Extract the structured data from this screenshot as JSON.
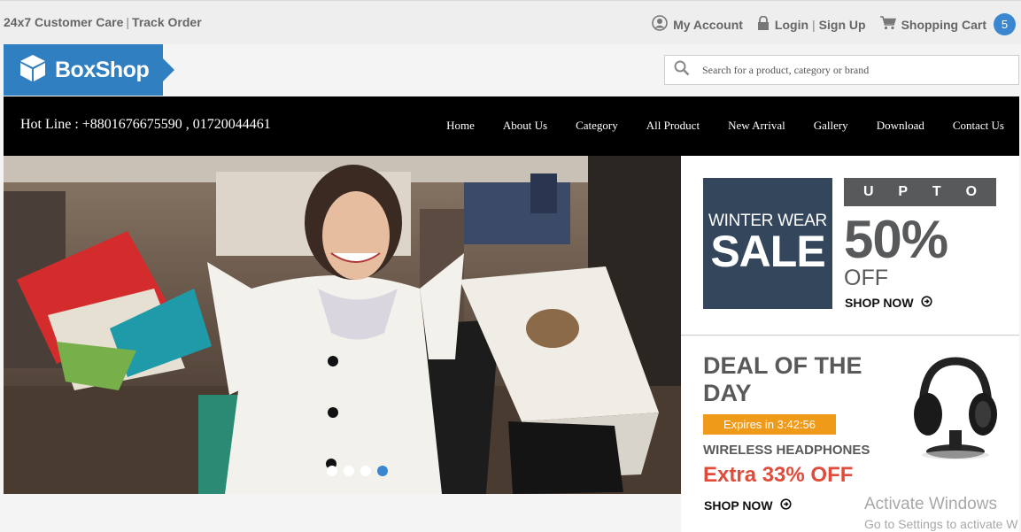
{
  "topbar": {
    "customer_care": "24x7 Customer Care",
    "separator": "|",
    "track_order": "Track Order",
    "my_account": "My Account",
    "login": "Login",
    "signup": "Sign Up",
    "shopping_cart": "Shopping Cart",
    "cart_count": "5"
  },
  "header": {
    "logo_text": "BoxShop",
    "search_placeholder": "Search for a product, category or brand"
  },
  "navbar": {
    "hotline": "Hot Line : +8801676675590 , 01720044461",
    "items": [
      "Home",
      "About Us",
      "Category",
      "All Product",
      "New Arrival",
      "Gallery",
      "Download",
      "Contact Us"
    ]
  },
  "slider": {
    "dot_count": 4,
    "active_index": 3
  },
  "promo_sale": {
    "line1": "WINTER WEAR",
    "line2": "SALE",
    "upto_letters": [
      "U",
      "P",
      "T",
      "O"
    ],
    "percent": "50%",
    "off": "OFF",
    "cta": "SHOP NOW"
  },
  "promo_deal": {
    "title": "DEAL OF THE DAY",
    "expires": "Expires in 3:42:56",
    "product": "WIRELESS HEADPHONES",
    "discount": "Extra 33% OFF",
    "cta": "SHOP NOW"
  },
  "watermark": {
    "line1": "Activate Windows",
    "line2": "Go to Settings to activate W"
  },
  "colors": {
    "brand_blue": "#2f7fc1",
    "badge_blue": "#3a86d0",
    "sale_navy": "#34465c",
    "grey_text": "#58595b",
    "orange": "#f09a1a",
    "red": "#e04b3a"
  }
}
